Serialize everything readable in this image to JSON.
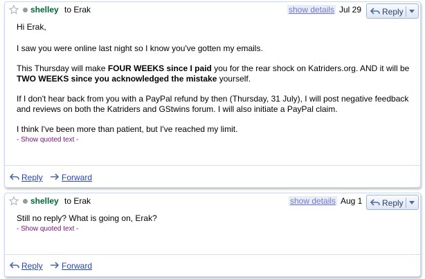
{
  "messages": [
    {
      "sender": "shelley",
      "to": "to Erak",
      "show_details": "show details",
      "date": "Jul 29",
      "reply_button": "Reply",
      "greeting": "Hi Erak,",
      "para1": "I saw you were online last night so I know you've gotten my emails.",
      "para2_a": "This Thursday will make ",
      "para2_b": "FOUR WEEKS since I paid",
      "para2_c": " you for the rear shock on Katriders.org. AND it will be",
      "para2_d": "TWO WEEKS since you acknowledged the mistake",
      "para2_e": " yourself.",
      "para3_line1": "If I don't hear back from you with a PayPal refund by then (Thursday, 31 July), I will post negative feedback",
      "para3_line2": "and reviews on both the Katriders and GStwins forum. I will also initiate a PayPal claim.",
      "para4": "I think I've been more than patient, but I've reached my limit.",
      "quoted": "- Show quoted text -",
      "reply_link": "Reply",
      "forward_link": "Forward"
    },
    {
      "sender": "shelley",
      "to": "to Erak",
      "show_details": "show details",
      "date": "Aug 1",
      "reply_button": "Reply",
      "para1": "Still no reply? What is going on, Erak?",
      "quoted": "- Show quoted text -",
      "reply_link": "Reply",
      "forward_link": "Forward"
    }
  ],
  "colors": {
    "sender": "#006633",
    "link": "#2244bb",
    "quoted": "#771177",
    "border": "#c3d9ff"
  },
  "icons": [
    "star-icon",
    "status-dot-icon",
    "reply-arrow-icon",
    "dropdown-arrow-icon",
    "forward-arrow-icon"
  ]
}
